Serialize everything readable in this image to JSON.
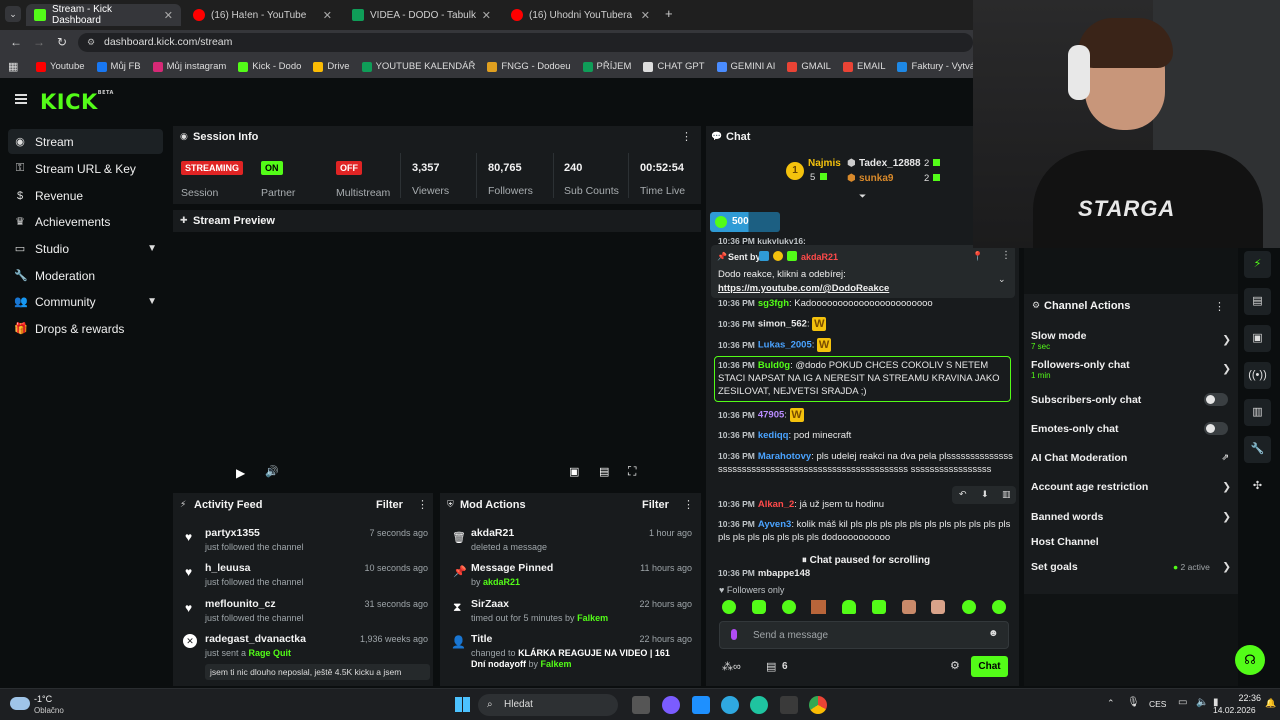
{
  "browser": {
    "tabs": [
      {
        "title": "Stream - Kick Dashboard",
        "color": "#53fc18"
      },
      {
        "title": "(16) Ha!en - YouTube",
        "color": "#ff0000"
      },
      {
        "title": "VIDEA - DODO - Tabulky Googl",
        "color": "#0f9d58"
      },
      {
        "title": "(16) Uhodni YouTubera Podle I",
        "color": "#ff0000"
      }
    ],
    "url": "dashboard.kick.com/stream",
    "bookmarks": [
      {
        "label": "Youtube",
        "color": "#ff0000"
      },
      {
        "label": "Můj FB",
        "color": "#1877f2"
      },
      {
        "label": "Můj instagram",
        "color": "#d62976"
      },
      {
        "label": "Kick - Dodo",
        "color": "#53fc18"
      },
      {
        "label": "Drive",
        "color": "#fbbc04"
      },
      {
        "label": "YOUTUBE KALENDÁŘ",
        "color": "#0f9d58"
      },
      {
        "label": "FNGG - Dodoeu",
        "color": "#e0a020"
      },
      {
        "label": "PŘÍJEM",
        "color": "#0f9d58"
      },
      {
        "label": "CHAT GPT",
        "color": "#dddddd"
      },
      {
        "label": "GEMINI AI",
        "color": "#4a8cff"
      },
      {
        "label": "GMAIL",
        "color": "#ea4335"
      },
      {
        "label": "EMAIL",
        "color": "#ea4335"
      },
      {
        "label": "Faktury - Vytváření",
        "color": "#1e88e5"
      },
      {
        "label": "PNG to PDF",
        "color": "#e53935"
      }
    ]
  },
  "brand": {
    "logo": "KICK",
    "beta": "BETA",
    "accent": "#53fc18"
  },
  "sidebar": {
    "items": [
      {
        "label": "Stream",
        "icon": "radio-icon"
      },
      {
        "label": "Stream URL & Key",
        "icon": "key-icon"
      },
      {
        "label": "Revenue",
        "icon": "dollar-icon"
      },
      {
        "label": "Achievements",
        "icon": "trophy-icon"
      },
      {
        "label": "Studio",
        "icon": "monitor-icon"
      },
      {
        "label": "Moderation",
        "icon": "wrench-icon"
      },
      {
        "label": "Community",
        "icon": "users-icon"
      },
      {
        "label": "Drops & rewards",
        "icon": "gift-icon"
      }
    ]
  },
  "session": {
    "title": "Session Info",
    "stats": [
      {
        "badge": "STREAMING",
        "label": "Session"
      },
      {
        "badge": "ON",
        "label": "Partner Income"
      },
      {
        "badge": "OFF",
        "label": "Multistream"
      },
      {
        "value": "3,357",
        "label": "Viewers"
      },
      {
        "value": "80,765",
        "label": "Followers"
      },
      {
        "value": "240",
        "label": "Sub Counts"
      },
      {
        "value": "00:52:54",
        "label": "Time Live"
      }
    ]
  },
  "preview": {
    "title": "Stream Preview"
  },
  "activity": {
    "title": "Activity Feed",
    "filter": "Filter",
    "items": [
      {
        "name": "partyx1355",
        "sub": "just followed the channel",
        "time": "7 seconds ago"
      },
      {
        "name": "h_leuusa",
        "sub": "just followed the channel",
        "time": "10 seconds ago"
      },
      {
        "name": "meflounito_cz",
        "sub": "just followed the channel",
        "time": "31 seconds ago"
      },
      {
        "name": "radegast_dvanactka",
        "sub": "just sent a",
        "highlight": "Rage Quit",
        "time": "1,936 weeks ago"
      }
    ],
    "cutoff": "jsem ti nic dlouho neposlal, ještě 4.5K kicku a jsem"
  },
  "mod": {
    "title": "Mod Actions",
    "filter": "Filter",
    "items": [
      {
        "name": "akdaR21",
        "sub": "deleted a message",
        "time": "1 hour ago"
      },
      {
        "name": "Message Pinned",
        "sub": "by",
        "by": "akdaR21",
        "time": "11 hours ago"
      },
      {
        "name": "SirZaax",
        "sub": "timed out for 5 minutes by",
        "by": "Falkem",
        "time": "22 hours ago"
      },
      {
        "name": "Title",
        "sub": "changed to",
        "bold": "KLÁRKA REAGUJE NA VIDEO | 161 Dní nodayoff",
        "by2": "by",
        "by": "Falkem",
        "time": "22 hours ago"
      }
    ]
  },
  "chat": {
    "title": "Chat",
    "leaders": [
      {
        "name": "Najmis",
        "count": "5"
      },
      {
        "name": "Tadex_12888",
        "count": "2"
      },
      {
        "name": "sunka9",
        "count": "2"
      }
    ],
    "gift_count": "500",
    "partial_top": "10:36 PM kukvlukv16:",
    "pinned": {
      "sent_by": "Sent by",
      "user": "akdaR21",
      "text": "Dodo reakce, klikni a odebírej:",
      "link": "https://m.youtube.com/@DodoReakce"
    },
    "messages": [
      {
        "time": "10:36 PM",
        "user": "sg3fgh",
        "color": "#53fc18",
        "text": "Kadooooooooooooooooooooooo"
      },
      {
        "time": "10:36 PM",
        "user": "simon_562",
        "color": "#e8e8e8",
        "emote": "W"
      },
      {
        "time": "10:36 PM",
        "user": "Lukas_2005",
        "color": "#4aa3ff",
        "emote": "W"
      },
      {
        "time": "10:36 PM",
        "user": "Buld0g",
        "color": "#53fc18",
        "text": "@dodo POKUD CHCES COKOLIV S NETEM STACI NAPSAT NA IG A NERESIT NA STREAMU KRAVINA JAKO ZESILOVAT, NEJVETSI SRAJDA ;)"
      },
      {
        "time": "10:36 PM",
        "user": "47905",
        "color": "#b98cff",
        "emote": "W"
      },
      {
        "time": "10:36 PM",
        "user": "kediqq",
        "color": "#4aa3ff",
        "text": "pod minecraft"
      },
      {
        "time": "10:36 PM",
        "user": "Marahotovy",
        "color": "#4aa3ff",
        "text": "pls udelej reakci na dva pela plssssssssssssssssssssssssssssssssssssssssssssssssssssss sssssssssssssssss"
      },
      {
        "time": "10:36 PM",
        "user": "Alkan_2",
        "color": "#ff4a4a",
        "text": "já už jsem tu hodinu"
      },
      {
        "time": "10:36 PM",
        "user": "Ayven3",
        "color": "#4aa3ff",
        "text": "kolik máš kil pls pls pls pls pls pls pls pls pls pls pls pls pls pls pls pls pls pls dodoooooooooo"
      },
      {
        "time": "10:36 PM",
        "user": "mbappe148",
        "color": "#e8e8e8",
        "text": ""
      }
    ],
    "paused": "Chat paused for scrolling",
    "followers_only": "Followers only",
    "input_placeholder": "Send a message",
    "count": "6",
    "send": "Chat"
  },
  "actions": {
    "title": "Channel Actions",
    "items": [
      {
        "label": "Slow mode",
        "sub": "7 sec",
        "type": "arrow"
      },
      {
        "label": "Followers-only chat",
        "sub": "1 min",
        "type": "arrow"
      },
      {
        "label": "Subscribers-only chat",
        "type": "toggle"
      },
      {
        "label": "Emotes-only chat",
        "type": "toggle"
      },
      {
        "label": "AI Chat Moderation",
        "type": "ext"
      },
      {
        "label": "Account age restriction",
        "type": "arrow"
      },
      {
        "label": "Banned words",
        "type": "arrow"
      },
      {
        "label": "Host Channel",
        "type": "none"
      },
      {
        "label": "Set goals",
        "extra": "2 active",
        "type": "arrow"
      }
    ]
  },
  "webcam": {
    "shirt": "STARGA"
  },
  "taskbar": {
    "temp": "-1°C",
    "weather": "Oblačno",
    "search": "Hledat",
    "lang": "CES",
    "time": "22:36",
    "date": "14.02.2026"
  }
}
